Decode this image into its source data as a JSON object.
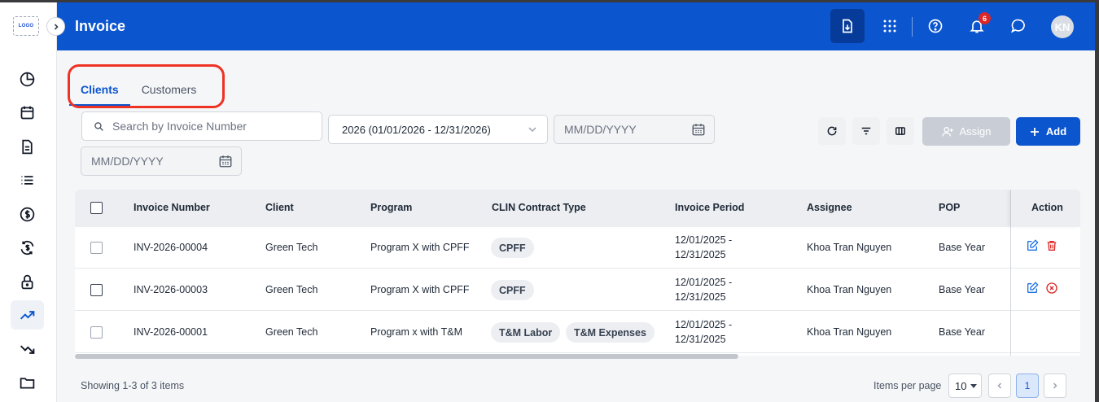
{
  "sidebar": {
    "logo": "LOGO",
    "items": [
      {
        "icon": "pie-chart-icon"
      },
      {
        "icon": "calendar-icon"
      },
      {
        "icon": "document-icon"
      },
      {
        "icon": "list-icon"
      },
      {
        "icon": "dollar-icon"
      },
      {
        "icon": "dollar-sync-icon"
      },
      {
        "icon": "lock-icon"
      },
      {
        "icon": "trending-up-icon",
        "active": true
      },
      {
        "icon": "trending-down-icon"
      },
      {
        "icon": "folder-icon"
      }
    ]
  },
  "header": {
    "title": "Invoice",
    "notification_count": "6",
    "avatar_initials": "KN",
    "brand_color": "#0b55cf"
  },
  "tabs": [
    {
      "label": "Clients",
      "active": true
    },
    {
      "label": "Customers",
      "active": false
    }
  ],
  "filters": {
    "search_placeholder": "Search by Invoice Number",
    "year_selected": "2026 (01/01/2026 - 12/31/2026)",
    "date_from_placeholder": "MM/DD/YYYY",
    "date_to_placeholder": "MM/DD/YYYY"
  },
  "toolbar": {
    "assign_label": "Assign",
    "add_label": "Add"
  },
  "table": {
    "columns": [
      "Invoice Number",
      "Client",
      "Program",
      "CLIN Contract Type",
      "Invoice Period",
      "Assignee",
      "POP",
      "Action"
    ],
    "rows": [
      {
        "invoice_number": "INV-2026-00004",
        "client": "Green Tech",
        "program": "Program X with CPFF",
        "clin": [
          "CPFF"
        ],
        "period_start": "12/01/2025 -",
        "period_end": "12/31/2025",
        "assignee": "Khoa Tran Nguyen",
        "pop": "Base Year",
        "actions": [
          "edit",
          "delete"
        ]
      },
      {
        "invoice_number": "INV-2026-00003",
        "client": "Green Tech",
        "program": "Program X with CPFF",
        "clin": [
          "CPFF"
        ],
        "period_start": "12/01/2025 -",
        "period_end": "12/31/2025",
        "assignee": "Khoa Tran Nguyen",
        "pop": "Base Year",
        "actions": [
          "edit",
          "cancel"
        ]
      },
      {
        "invoice_number": "INV-2026-00001",
        "client": "Green Tech",
        "program": "Program x with T&M",
        "clin": [
          "T&M Labor",
          "T&M Expenses"
        ],
        "period_start": "12/01/2025 -",
        "period_end": "12/31/2025",
        "assignee": "Khoa Tran Nguyen",
        "pop": "Base Year",
        "actions": []
      }
    ]
  },
  "footer": {
    "showing": "Showing 1-3 of 3 items",
    "items_per_page_label": "Items per page",
    "items_per_page": "10",
    "current_page": "1"
  }
}
